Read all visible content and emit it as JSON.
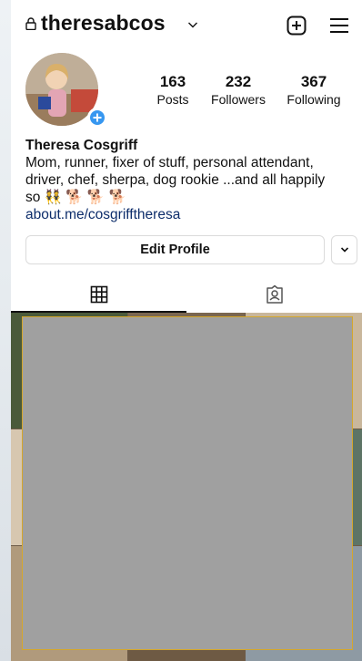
{
  "header": {
    "username": "theresabcos",
    "icons": [
      "lock-icon",
      "chevron-down-icon",
      "new-post-icon",
      "menu-icon"
    ]
  },
  "profile": {
    "stats": [
      {
        "count": "163",
        "label": "Posts"
      },
      {
        "count": "232",
        "label": "Followers"
      },
      {
        "count": "367",
        "label": "Following"
      }
    ],
    "name": "Theresa Cosgriff",
    "bio_line1": "Mom, runner, fixer of stuff, personal attendant,",
    "bio_line2": "driver, chef, sherpa, dog rookie ...and all happily",
    "bio_line3": "so 👯 🐕 🐕 🐕",
    "link": "about.me/cosgrifftheresa"
  },
  "actions": {
    "edit_profile": "Edit Profile"
  },
  "tabs": [
    {
      "name": "grid",
      "icon": "grid-icon",
      "active": true
    },
    {
      "name": "tagged",
      "icon": "tagged-icon",
      "active": false
    }
  ],
  "colors": {
    "accent": "#3797f0",
    "link": "#0d2d6b",
    "border": "#dbdbdb",
    "redaction_fill": "#a0a0a0",
    "redaction_border": "#d4a72c"
  }
}
